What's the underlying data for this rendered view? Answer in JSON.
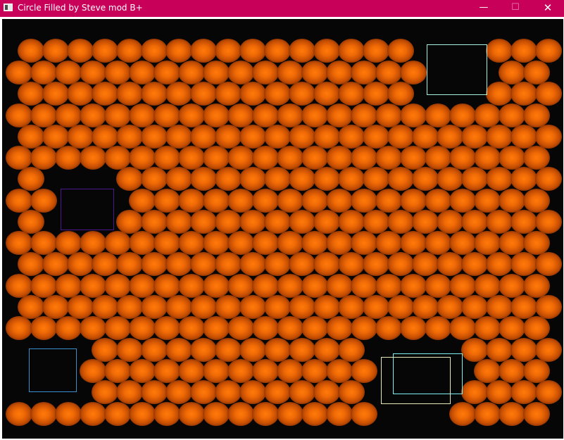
{
  "window": {
    "title": "Circle Filled by Steve mod B+",
    "icons": {
      "app": "app-window-icon",
      "minimize": "minimize-icon",
      "maximize": "maximize-icon",
      "close": "close-icon"
    },
    "controls": {
      "minimize": "—",
      "maximize": "☐",
      "close": "✕"
    },
    "colors": {
      "titlebar": "#c8005a",
      "canvas": "#060606",
      "circle_core": "#ff7a0a",
      "circle_edge": "#6e2600"
    }
  },
  "canvas": {
    "description_shapes": "orange glowing circles in a staggered grid with empty outlined rectangles",
    "rectangle_colors": [
      "#a7f2e0",
      "#4a1a8c",
      "#3a8ecc",
      "#80f0f0",
      "#e8e8b8"
    ]
  }
}
